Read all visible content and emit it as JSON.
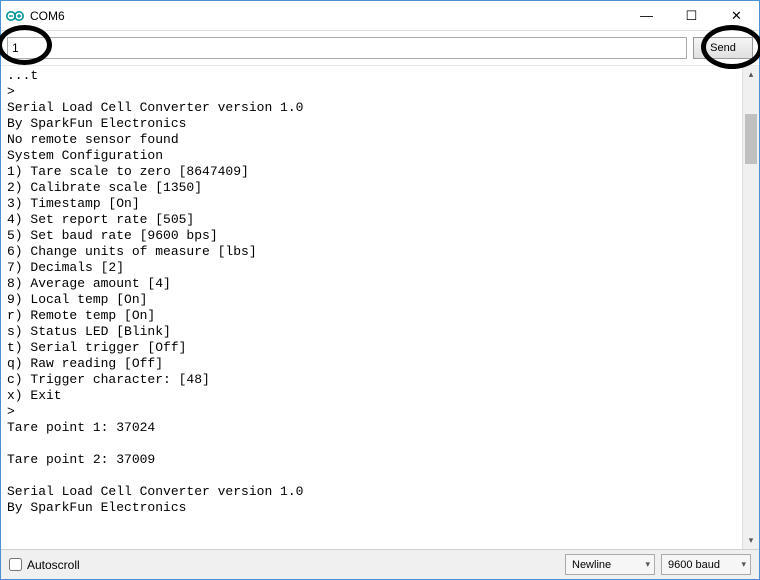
{
  "window": {
    "title": "COM6",
    "minimize": "—",
    "maximize": "☐",
    "close": "✕"
  },
  "input": {
    "value": "1",
    "send_label": "Send"
  },
  "console": [
    "...t",
    ">",
    "Serial Load Cell Converter version 1.0",
    "By SparkFun Electronics",
    "No remote sensor found",
    "System Configuration",
    "1) Tare scale to zero [8647409]",
    "2) Calibrate scale [1350]",
    "3) Timestamp [On]",
    "4) Set report rate [505]",
    "5) Set baud rate [9600 bps]",
    "6) Change units of measure [lbs]",
    "7) Decimals [2]",
    "8) Average amount [4]",
    "9) Local temp [On]",
    "r) Remote temp [On]",
    "s) Status LED [Blink]",
    "t) Serial trigger [Off]",
    "q) Raw reading [Off]",
    "c) Trigger character: [48]",
    "x) Exit",
    ">",
    "Tare point 1: 37024",
    "",
    "Tare point 2: 37009",
    "",
    "Serial Load Cell Converter version 1.0",
    "By SparkFun Electronics"
  ],
  "bottom": {
    "autoscroll_label": "Autoscroll",
    "line_ending": "Newline",
    "baud": "9600 baud"
  }
}
